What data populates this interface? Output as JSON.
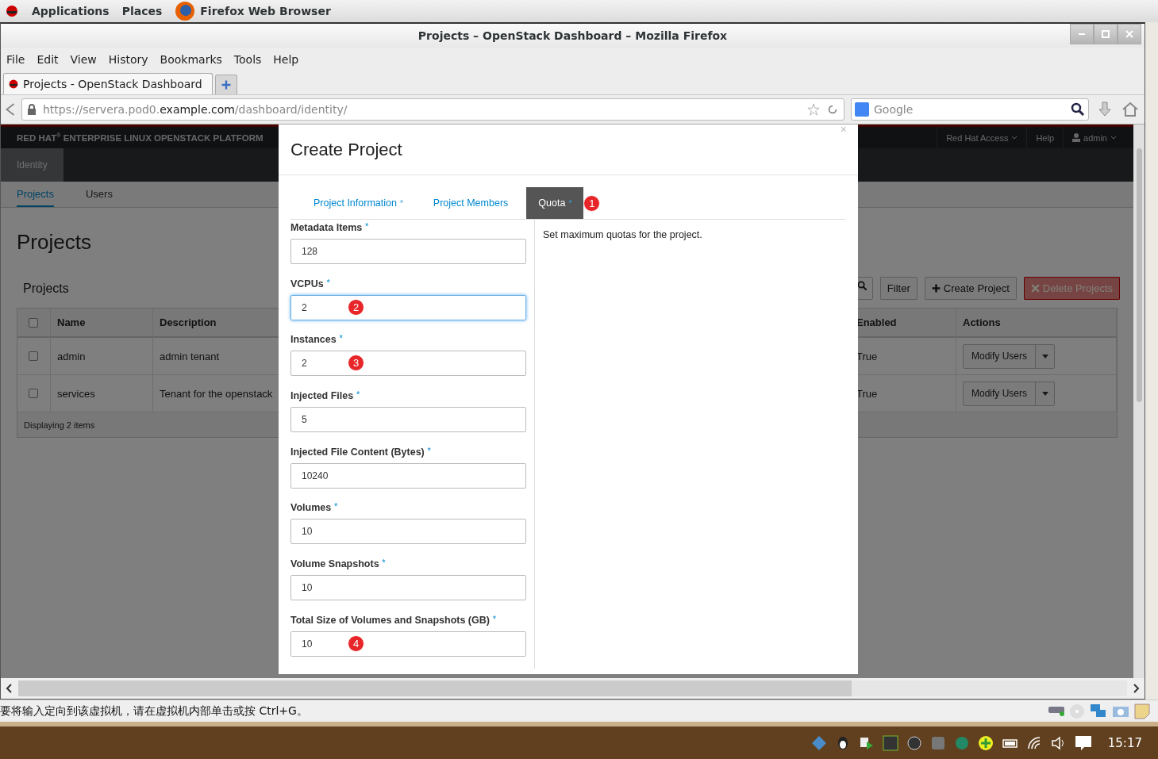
{
  "top_bar": {
    "menus": [
      "Applications",
      "Places"
    ],
    "app": "Firefox Web Browser"
  },
  "window": {
    "title": "Projects – OpenStack Dashboard – Mozilla Firefox"
  },
  "menu": [
    "File",
    "Edit",
    "View",
    "History",
    "Bookmarks",
    "Tools",
    "Help"
  ],
  "tabs": [
    {
      "label": "Projects - OpenStack Dashboard",
      "selected": true
    }
  ],
  "address_bar": {
    "url": "https://servera.pod0.**example.com**/dashboard/identity/"
  },
  "search": {
    "placeholder": "Google"
  },
  "dashboard": {
    "brand": "RED HAT$^{®}$ ENTERPRISE LINUX OPENSTACK PLATFORM",
    "header_links": [
      {
        "label": "Red Hat Access",
        "kind": "dropdown"
      },
      {
        "label": "Help",
        "kind": "link"
      },
      {
        "label": "admin",
        "kind": "user"
      }
    ],
    "sections": [
      {
        "label": "Identity",
        "selected": true
      }
    ],
    "subnav": [
      {
        "label": "Projects",
        "selected": true
      },
      {
        "label": "Users",
        "selected": false
      }
    ],
    "title": "Projects",
    "panel_title": "Projects",
    "toolbar": [
      {
        "label": "Filter",
        "kind": "plain"
      },
      {
        "label": "Create Project",
        "kind": "create"
      },
      {
        "label": "Delete Projects",
        "kind": "delete"
      }
    ],
    "table": {
      "select_all_checked": false,
      "columns": [
        "Name",
        "Description",
        "Enabled",
        "Actions"
      ],
      "rows": [
        {
          "checked": false,
          "name": "admin",
          "description": "admin tenant",
          "enabled": "True",
          "action": "Modify Users"
        },
        {
          "checked": false,
          "name": "services",
          "description": "Tenant for the openstack",
          "enabled": "True",
          "action": "Modify Users"
        }
      ],
      "footer": "Displaying 2 items"
    }
  },
  "modal": {
    "title": "Create Project",
    "close": "×",
    "tabs": [
      {
        "label": "Project Information",
        "mark": "*",
        "selected": false
      },
      {
        "label": "Project Members",
        "selected": false
      },
      {
        "label": "Quota",
        "mark": "*",
        "selected": true,
        "marker": "1"
      }
    ],
    "fields": [
      {
        "label": "Metadata Items",
        "mark": "*",
        "value": "128",
        "focused": false
      },
      {
        "label": "VCPUs",
        "mark": "*",
        "value": "2",
        "focused": true,
        "marker": "2"
      },
      {
        "label": "Instances",
        "mark": "*",
        "value": "2",
        "focused": false,
        "marker": "3"
      },
      {
        "label": "Injected Files",
        "mark": "*",
        "value": "5",
        "focused": false
      },
      {
        "label": "Injected File Content (Bytes)",
        "mark": "*",
        "value": "10240",
        "focused": false
      },
      {
        "label": "Volumes",
        "mark": "*",
        "value": "10",
        "focused": false
      },
      {
        "label": "Volume Snapshots",
        "mark": "*",
        "value": "10",
        "focused": false
      },
      {
        "label": "Total Size of Volumes and Snapshots (GB)",
        "mark": "*",
        "value": "10",
        "focused": false,
        "marker": "4"
      }
    ],
    "help": "Set maximum quotas for the project."
  },
  "status_bar": {
    "message": "要将输入定向到该虚拟机，请在虚拟机内部单击或按 Ctrl+G。"
  },
  "taskbar": {
    "clock": "15:17"
  }
}
